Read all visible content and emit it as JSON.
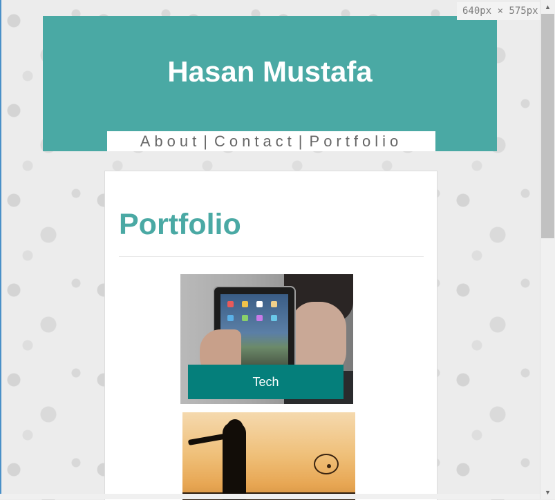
{
  "header": {
    "site_title": "Hasan Mustafa",
    "background_color": "#4aa9a4",
    "nav": [
      {
        "label": "About"
      },
      {
        "label": "Contact"
      },
      {
        "label": "Portfolio"
      }
    ],
    "nav_separator": "|"
  },
  "main": {
    "heading": "Portfolio",
    "heading_color": "#4aa9a4",
    "items": [
      {
        "label": "Tech",
        "image": "person-holding-tablet-photo",
        "label_background": "#057f7b"
      },
      {
        "label": "",
        "image": "cricket-batter-silhouette-photo"
      }
    ]
  },
  "viewport_indicator": "640px × 575px",
  "scrollbar": {
    "up_icon": "scroll-up-arrow-icon",
    "down_icon": "scroll-down-arrow-icon"
  }
}
